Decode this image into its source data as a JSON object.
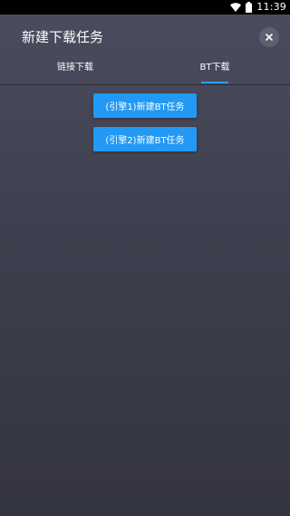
{
  "status_bar": {
    "time": "11:39",
    "icons": [
      "wifi-icon",
      "battery-icon"
    ]
  },
  "header": {
    "title": "新建下载任务",
    "close_icon": "close-icon"
  },
  "tabs": [
    {
      "label": "链接下载",
      "selected": false
    },
    {
      "label": "BT下载",
      "selected": true
    }
  ],
  "actions": {
    "engine1_label": "(引擎1)新建BT任务",
    "engine2_label": "(引擎2)新建BT任务"
  },
  "colors": {
    "accent": "#2299f4",
    "background_top": "#4b4d5f",
    "background_bottom": "#343540",
    "close_button_bg": "#5e6070"
  }
}
